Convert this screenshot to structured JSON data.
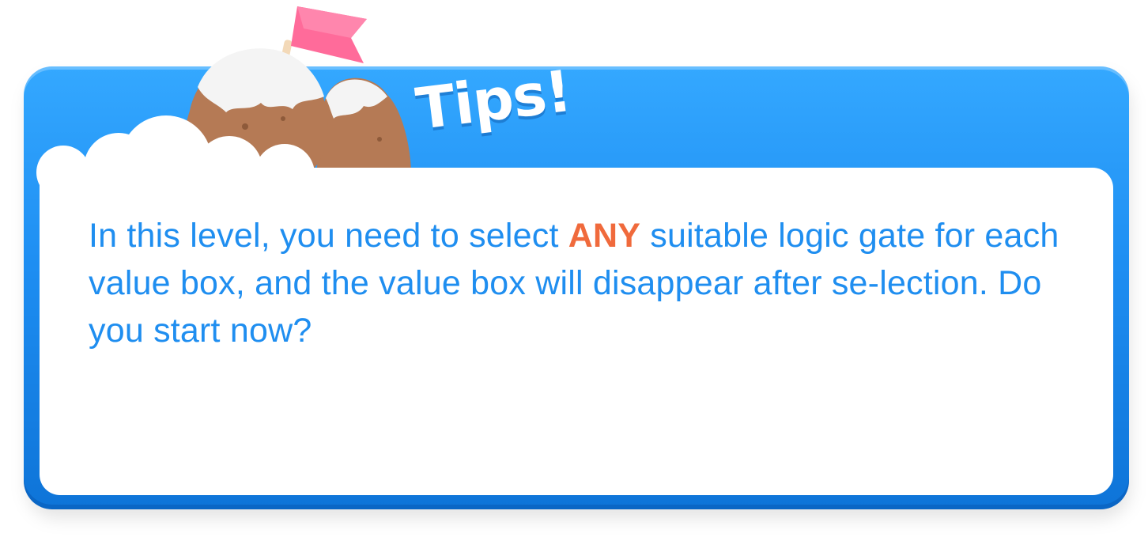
{
  "dialog": {
    "title": "Tips!",
    "message": {
      "before": "In this level, you need to select ",
      "highlight": "ANY",
      "after": " suitable logic gate for each value box, and the value box will disappear after se-lection. Do you start now?"
    },
    "decoration_icon": "mountain-flag-icon"
  },
  "colors": {
    "panel_blue": "#1e8ef2",
    "text_blue": "#1f8ef0",
    "highlight_orange": "#f06a3c",
    "flag_pink": "#ff6b9a"
  }
}
